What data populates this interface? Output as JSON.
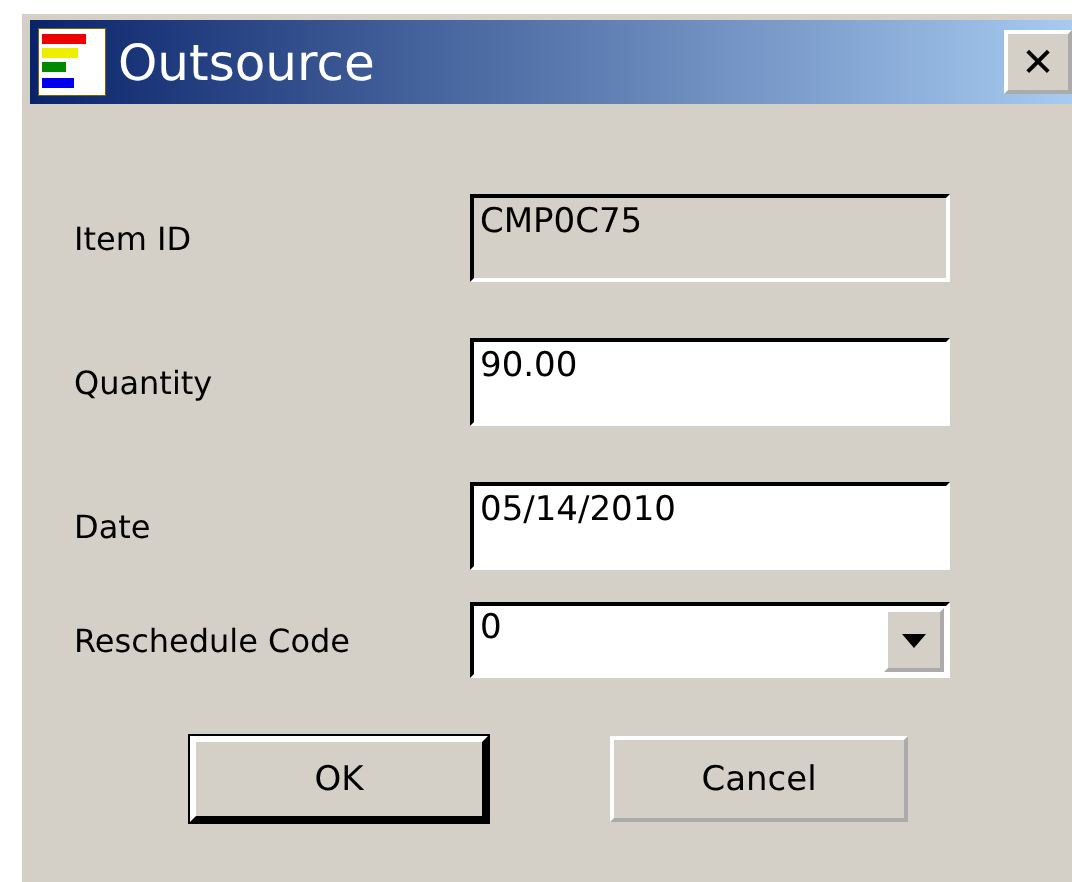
{
  "window": {
    "title": "Outsource",
    "close_glyph": "✕"
  },
  "fields": [
    {
      "label": "Item ID",
      "value": "CMP0C75",
      "kind": "text",
      "disabled": true
    },
    {
      "label": "Quantity",
      "value": "90.00",
      "kind": "text",
      "disabled": false
    },
    {
      "label": "Date",
      "value": "05/14/2010",
      "kind": "text",
      "disabled": false
    },
    {
      "label": "Reschedule Code",
      "value": "0",
      "kind": "dropdown",
      "disabled": false
    }
  ],
  "buttons": [
    {
      "label": "OK",
      "default": true
    },
    {
      "label": "Cancel",
      "default": false
    }
  ]
}
